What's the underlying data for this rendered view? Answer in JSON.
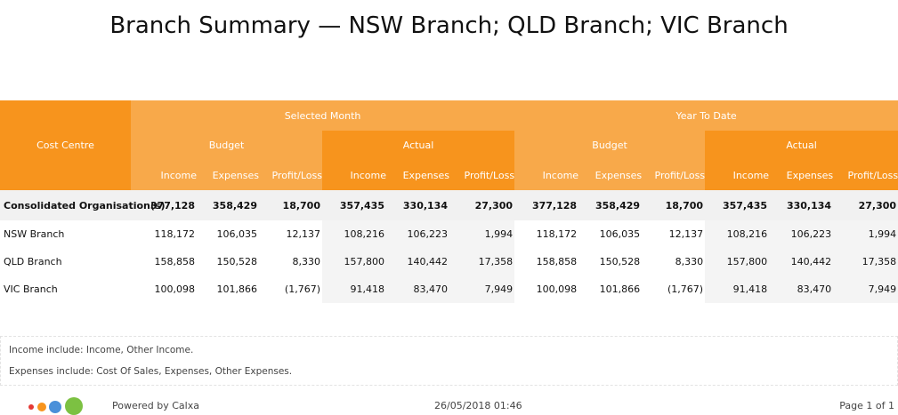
{
  "title": "Branch Summary — NSW Branch; QLD Branch; VIC Branch",
  "colors": {
    "header_dark": "#f7941d",
    "header_light": "#f8a94a",
    "negative": "#cc0000"
  },
  "header": {
    "cost_centre": "Cost Centre",
    "selected_month": "Selected Month",
    "year_to_date": "Year To Date",
    "budget": "Budget",
    "actual": "Actual",
    "income": "Income",
    "expenses": "Expenses",
    "profit_loss": "Profit/Loss"
  },
  "rows": [
    {
      "name": "Consolidated Organisation(s)",
      "values": [
        "377,128",
        "358,429",
        "18,700",
        "357,435",
        "330,134",
        "27,300",
        "377,128",
        "358,429",
        "18,700",
        "357,435",
        "330,134",
        "27,300"
      ]
    },
    {
      "name": "NSW Branch",
      "values": [
        "118,172",
        "106,035",
        "12,137",
        "108,216",
        "106,223",
        "1,994",
        "118,172",
        "106,035",
        "12,137",
        "108,216",
        "106,223",
        "1,994"
      ]
    },
    {
      "name": "QLD Branch",
      "values": [
        "158,858",
        "150,528",
        "8,330",
        "157,800",
        "140,442",
        "17,358",
        "158,858",
        "150,528",
        "8,330",
        "157,800",
        "140,442",
        "17,358"
      ]
    },
    {
      "name": "VIC Branch",
      "values": [
        "100,098",
        "101,866",
        "(1,767)",
        "91,418",
        "83,470",
        "7,949",
        "100,098",
        "101,866",
        "(1,767)",
        "91,418",
        "83,470",
        "7,949"
      ]
    }
  ],
  "notes": {
    "income": "Income include: Income,  Other Income.",
    "expenses": "Expenses include: Cost Of Sales,  Expenses,  Other Expenses."
  },
  "footer": {
    "powered_by": "Powered by Calxa",
    "date": "26/05/2018 01:46",
    "page": "Page 1 of 1",
    "logo_icon": "calxa-logo-icon"
  }
}
